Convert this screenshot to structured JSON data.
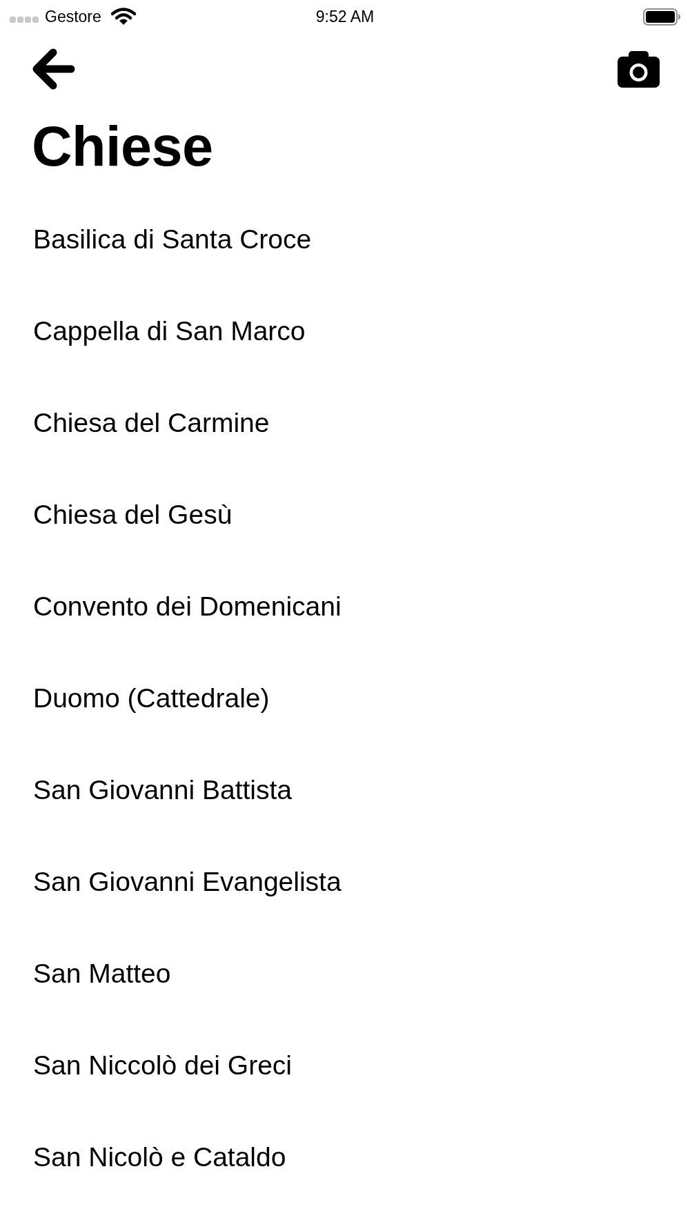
{
  "status_bar": {
    "carrier": "Gestore",
    "time": "9:52 AM"
  },
  "header": {
    "title": "Chiese"
  },
  "items": [
    {
      "label": "Basilica di Santa Croce"
    },
    {
      "label": "Cappella di San Marco"
    },
    {
      "label": "Chiesa del Carmine"
    },
    {
      "label": "Chiesa del Gesù"
    },
    {
      "label": "Convento dei Domenicani"
    },
    {
      "label": "Duomo (Cattedrale)"
    },
    {
      "label": "San Giovanni Battista"
    },
    {
      "label": "San Giovanni Evangelista"
    },
    {
      "label": "San Matteo"
    },
    {
      "label": "San Niccolò dei Greci"
    },
    {
      "label": "San Nicolò e Cataldo"
    }
  ]
}
